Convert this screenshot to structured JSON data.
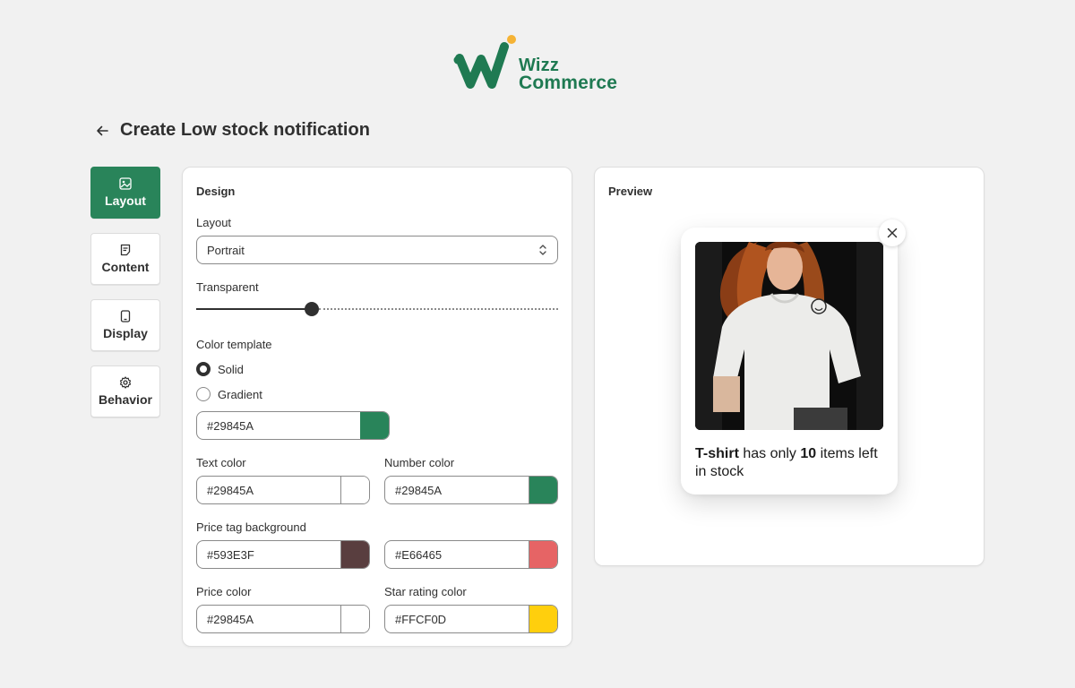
{
  "brand": {
    "name_line1": "Wizz",
    "name_line2": "Commerce",
    "color": "#1f7a52",
    "dot_color": "#f5b335"
  },
  "header": {
    "title": "Create Low stock notification",
    "back_icon": "arrow-left-icon"
  },
  "sidebar": {
    "items": [
      {
        "label": "Layout",
        "icon": "image-layout-icon",
        "active": true
      },
      {
        "label": "Content",
        "icon": "note-icon",
        "active": false
      },
      {
        "label": "Display",
        "icon": "tablet-icon",
        "active": false
      },
      {
        "label": "Behavior",
        "icon": "gear-icon",
        "active": false
      }
    ],
    "active_color": "#29845A"
  },
  "design": {
    "title": "Design",
    "layout_label": "Layout",
    "layout_value": "Portrait",
    "transparent_label": "Transparent",
    "transparent_level": 0.32,
    "color_template_label": "Color template",
    "options": [
      "Solid",
      "Gradient"
    ],
    "selected_option": "Solid",
    "template_color": "#29845A",
    "text_color_label": "Text color",
    "text_color": "#29845A",
    "text_color_swatch": "#FFFFFF",
    "number_color_label": "Number color",
    "number_color": "#29845A",
    "price_tag_bg_label": "Price tag background",
    "price_tag_bg": "#593E3F",
    "price_tag_bg_2": "#E66465",
    "price_color_label": "Price color",
    "price_color": "#29845A",
    "price_color_swatch": "#FFFFFF",
    "star_rating_label": "Star rating color",
    "star_rating_color": "#FFCF0D"
  },
  "preview": {
    "title": "Preview",
    "product_name": "T-shirt",
    "msg_part1": " has only ",
    "count": "10",
    "msg_part2": " items left in stock"
  }
}
